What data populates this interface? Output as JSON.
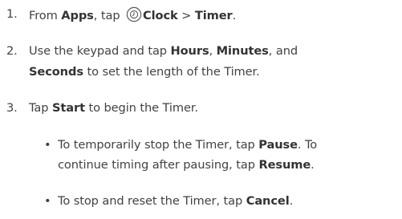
{
  "steps": [
    {
      "number": "1.",
      "segments": [
        "From ",
        "Apps",
        ", tap ",
        "Clock",
        " > ",
        "Timer",
        "."
      ],
      "icon": "clock-app-icon"
    },
    {
      "number": "2.",
      "lines": [
        [
          "Use the keypad and tap ",
          "Hours",
          ", ",
          "Minutes",
          ", and"
        ],
        [
          "Seconds",
          " to set the length of the Timer."
        ]
      ]
    },
    {
      "number": "3.",
      "segments": [
        "Tap ",
        "Start",
        " to begin the Timer."
      ],
      "bullets": [
        {
          "symbol": "•",
          "lines": [
            [
              "To temporarily stop the Timer, tap ",
              "Pause",
              ". To"
            ],
            [
              "continue timing after pausing, tap ",
              "Resume",
              "."
            ]
          ]
        },
        {
          "symbol": "•",
          "lines": [
            [
              "To stop and reset the Timer, tap ",
              "Cancel",
              "."
            ]
          ]
        }
      ]
    }
  ],
  "colors": {
    "text": "#424242",
    "bold": "#333333",
    "icon_stroke": "#5a5a5a"
  }
}
